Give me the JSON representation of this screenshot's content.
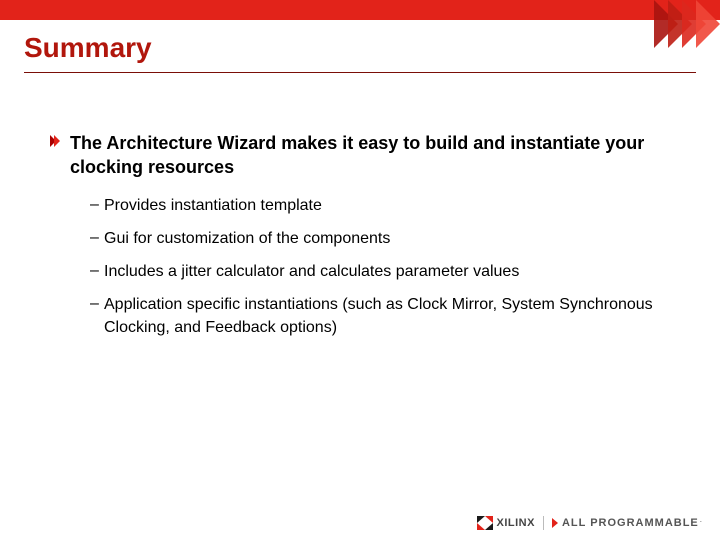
{
  "title": "Summary",
  "lead": "The Architecture Wizard makes it easy to build and instantiate your clocking resources",
  "sub1": "Provides instantiation template",
  "sub2": "Gui for customization of the components",
  "sub3": "Includes a jitter calculator and calculates parameter values",
  "sub4": "Application specific instantiations (such as Clock Mirror, System Synchronous Clocking, and Feedback options)",
  "brand": "XILINX",
  "tagline": "ALL PROGRAMMABLE",
  "dot": "."
}
